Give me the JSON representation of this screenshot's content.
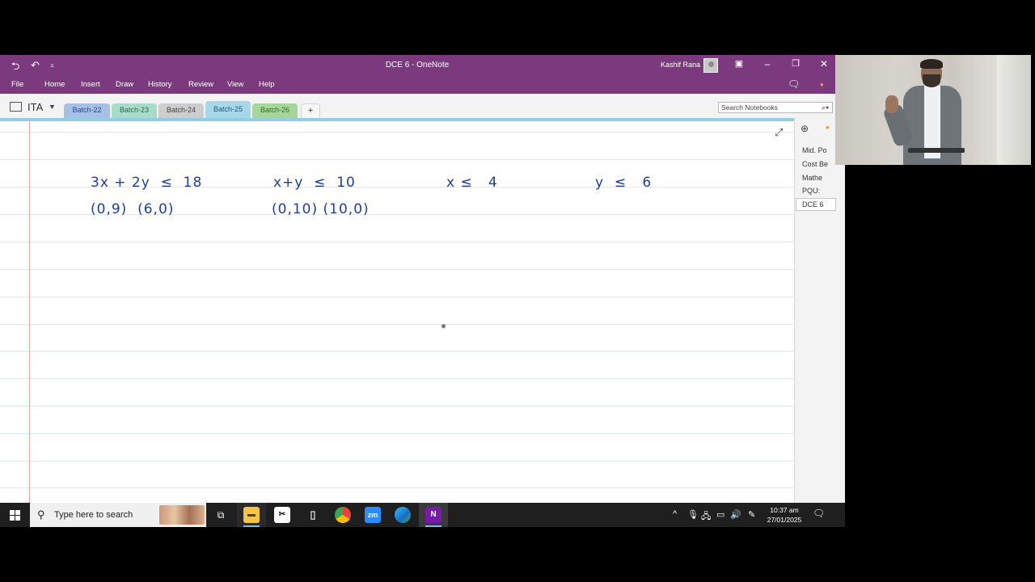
{
  "window": {
    "title": "DCE 6  -  OneNote",
    "user": "Kashif Rana"
  },
  "menu": [
    "File",
    "Home",
    "Insert",
    "Draw",
    "History",
    "Review",
    "View",
    "Help"
  ],
  "notebook": {
    "name": "ITA",
    "tabs": [
      {
        "label": "Batch-22",
        "color": "#a8bfe6"
      },
      {
        "label": "Batch-23",
        "color": "#a9dcc8"
      },
      {
        "label": "Batch-24",
        "color": "#cdcdcd"
      },
      {
        "label": "Batch-25",
        "color": "#a7d8ea"
      },
      {
        "label": "Batch-26",
        "color": "#a8d69a"
      }
    ],
    "add_tab": "+",
    "search_placeholder": "Search Notebooks"
  },
  "handwriting": {
    "l1": "3x + 2y  ≤  18",
    "l2": "(0,9)  (6,0)",
    "l3": "x+y  ≤  10",
    "l4": "(0,10) (10,0)",
    "l5": "x ≤   4",
    "l6": "y  ≤   6"
  },
  "pages": [
    "Mid. Po",
    "Cost Be",
    "Mathe",
    "PQU:",
    "DCE 6"
  ],
  "taskbar": {
    "search_text": "Type here to search",
    "time": "10:37 am",
    "date": "27/01/2025"
  },
  "colors": {
    "accent": "#7b3a7e",
    "ink": "#1f3f9a",
    "tab_line": "#8fcfe4"
  }
}
